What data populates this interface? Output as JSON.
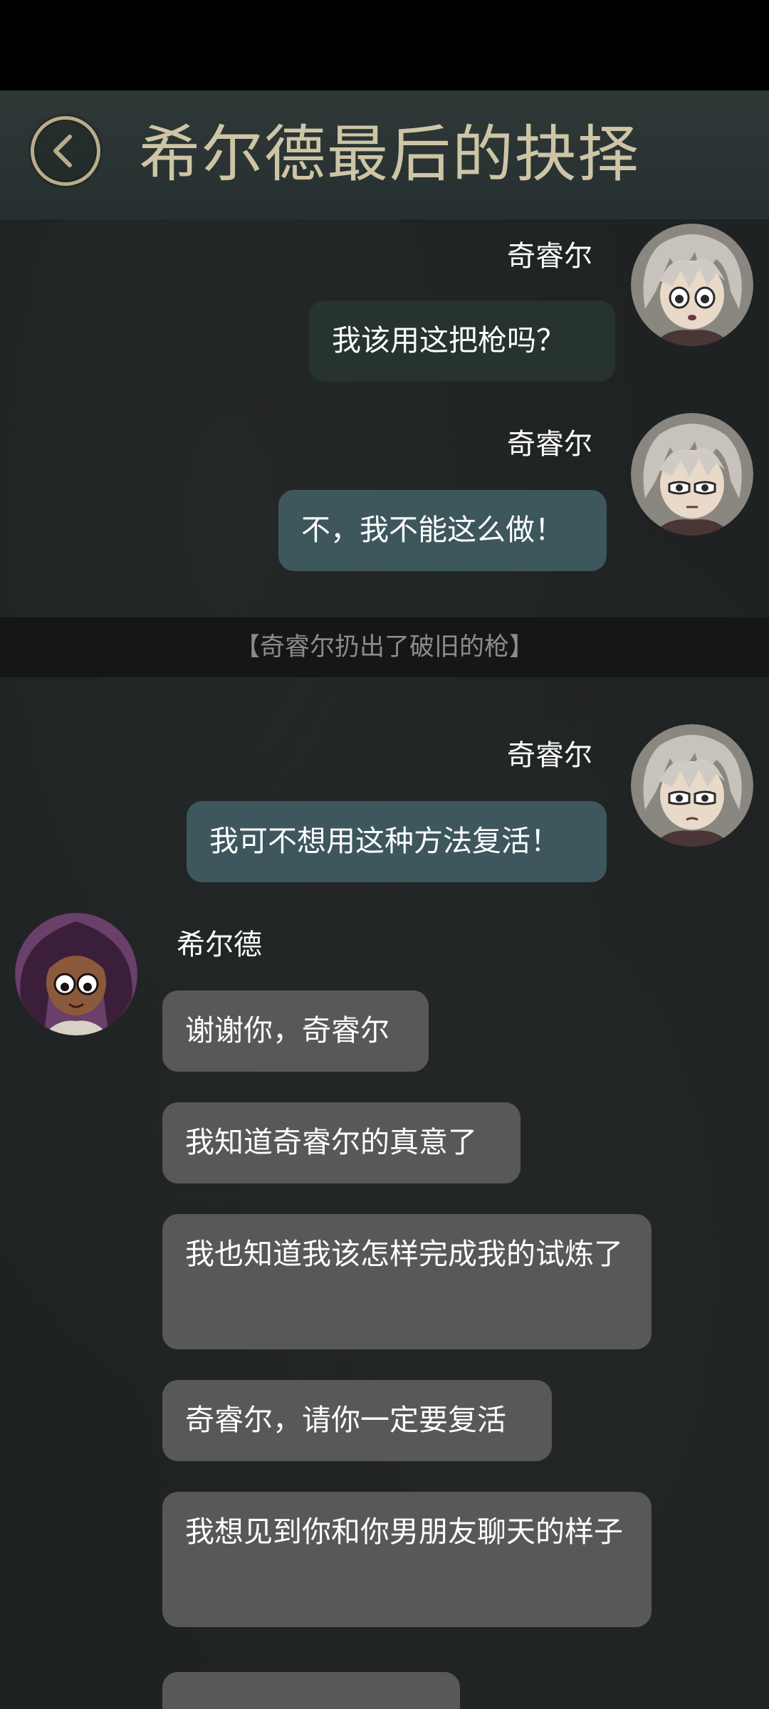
{
  "header": {
    "title": "希尔德最后的抉择",
    "back_icon": "chevron-left-icon",
    "accent_color": "#b8ad8a"
  },
  "messages": [
    {
      "sender": "奇睿尔",
      "side": "right",
      "text": "我该用这把枪吗？"
    },
    {
      "sender": "奇睿尔",
      "side": "right",
      "text": "不，我不能这么做！"
    },
    {
      "sender": "奇睿尔",
      "side": "right",
      "text": "我可不想用这种方法复活！"
    },
    {
      "sender": "希尔德",
      "side": "left",
      "text": "谢谢你，奇睿尔"
    },
    {
      "sender": "",
      "side": "left",
      "text": "我知道奇睿尔的真意了"
    },
    {
      "sender": "",
      "side": "left",
      "text": "我也知道我该怎样完成我的试炼了"
    },
    {
      "sender": "",
      "side": "left",
      "text": "奇睿尔，请你一定要复活"
    },
    {
      "sender": "",
      "side": "left",
      "text": "我想见到你和你男朋友聊天的样子"
    }
  ],
  "narration": "【奇睿尔扔出了破旧的枪】"
}
